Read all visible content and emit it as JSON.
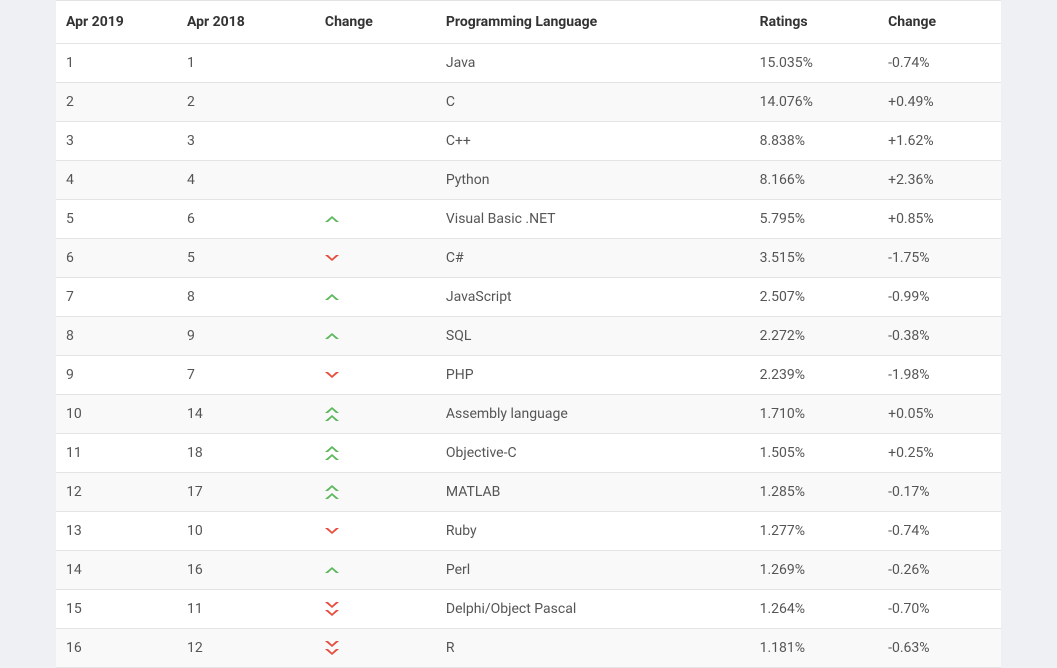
{
  "header": {
    "col1": "Apr 2019",
    "col2": "Apr 2018",
    "col3": "Change",
    "col4": "Programming Language",
    "col5": "Ratings",
    "col6": "Change"
  },
  "colors": {
    "up": "#5cb85c",
    "down": "#e74c3c"
  },
  "rows": [
    {
      "apr2019": "1",
      "apr2018": "1",
      "dir": "",
      "language": "Java",
      "ratings": "15.035%",
      "change": "-0.74%"
    },
    {
      "apr2019": "2",
      "apr2018": "2",
      "dir": "",
      "language": "C",
      "ratings": "14.076%",
      "change": "+0.49%"
    },
    {
      "apr2019": "3",
      "apr2018": "3",
      "dir": "",
      "language": "C++",
      "ratings": "8.838%",
      "change": "+1.62%"
    },
    {
      "apr2019": "4",
      "apr2018": "4",
      "dir": "",
      "language": "Python",
      "ratings": "8.166%",
      "change": "+2.36%"
    },
    {
      "apr2019": "5",
      "apr2018": "6",
      "dir": "up",
      "language": "Visual Basic .NET",
      "ratings": "5.795%",
      "change": "+0.85%"
    },
    {
      "apr2019": "6",
      "apr2018": "5",
      "dir": "down",
      "language": "C#",
      "ratings": "3.515%",
      "change": "-1.75%"
    },
    {
      "apr2019": "7",
      "apr2018": "8",
      "dir": "up",
      "language": "JavaScript",
      "ratings": "2.507%",
      "change": "-0.99%"
    },
    {
      "apr2019": "8",
      "apr2018": "9",
      "dir": "up",
      "language": "SQL",
      "ratings": "2.272%",
      "change": "-0.38%"
    },
    {
      "apr2019": "9",
      "apr2018": "7",
      "dir": "down",
      "language": "PHP",
      "ratings": "2.239%",
      "change": "-1.98%"
    },
    {
      "apr2019": "10",
      "apr2018": "14",
      "dir": "up-double",
      "language": "Assembly language",
      "ratings": "1.710%",
      "change": "+0.05%"
    },
    {
      "apr2019": "11",
      "apr2018": "18",
      "dir": "up-double",
      "language": "Objective-C",
      "ratings": "1.505%",
      "change": "+0.25%"
    },
    {
      "apr2019": "12",
      "apr2018": "17",
      "dir": "up-double",
      "language": "MATLAB",
      "ratings": "1.285%",
      "change": "-0.17%"
    },
    {
      "apr2019": "13",
      "apr2018": "10",
      "dir": "down",
      "language": "Ruby",
      "ratings": "1.277%",
      "change": "-0.74%"
    },
    {
      "apr2019": "14",
      "apr2018": "16",
      "dir": "up",
      "language": "Perl",
      "ratings": "1.269%",
      "change": "-0.26%"
    },
    {
      "apr2019": "15",
      "apr2018": "11",
      "dir": "down-double",
      "language": "Delphi/Object Pascal",
      "ratings": "1.264%",
      "change": "-0.70%"
    },
    {
      "apr2019": "16",
      "apr2018": "12",
      "dir": "down-double",
      "language": "R",
      "ratings": "1.181%",
      "change": "-0.63%"
    }
  ]
}
